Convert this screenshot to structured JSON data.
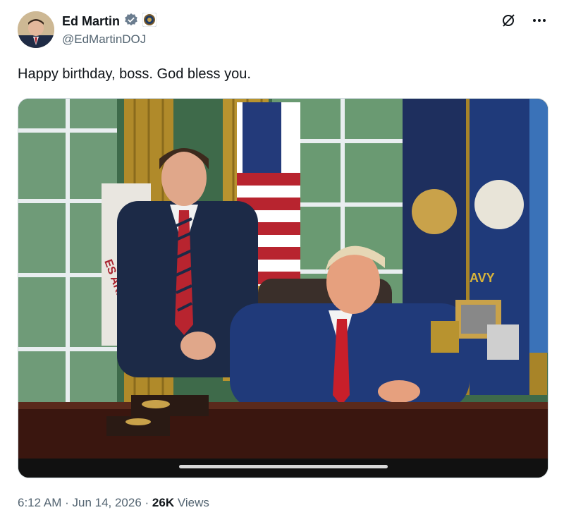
{
  "author": {
    "name": "Ed Martin",
    "handle": "@EdMartinDOJ",
    "verified_badge_icon": "verified-badge-icon",
    "affiliate_badge_icon": "doj-seal-icon"
  },
  "actions": {
    "grok_icon": "grok-icon",
    "more_icon": "more-options-icon"
  },
  "tweet": {
    "text": "Happy birthday, boss.  God bless you."
  },
  "media": {
    "type": "photo",
    "banner_text_left": "ES ARM",
    "banner_text_right": "AVY"
  },
  "meta": {
    "time": "6:12 AM",
    "sep1": " · ",
    "date": "Jun 14, 2026",
    "sep2": " · ",
    "views_count": "26K",
    "views_label": " Views"
  },
  "colors": {
    "text_primary": "#0f1419",
    "text_secondary": "#536471",
    "verified_blue": "#6b7d8f",
    "border": "#cfd9de"
  }
}
